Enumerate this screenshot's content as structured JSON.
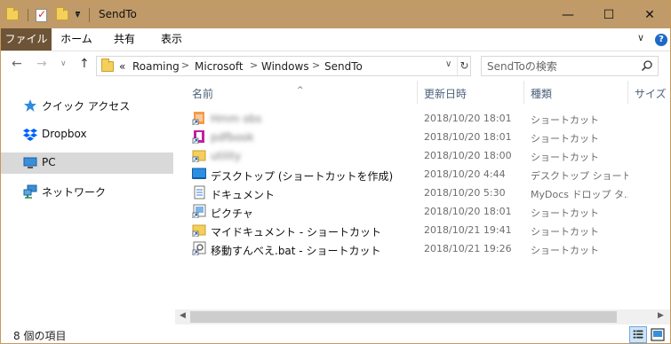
{
  "window": {
    "title": "SendTo",
    "minimize_glyph": "—",
    "maximize_glyph": "☐",
    "close_glyph": "✕"
  },
  "ribbon": {
    "tabs": [
      "ファイル",
      "ホーム",
      "共有",
      "表示"
    ],
    "expand_glyph": "∨",
    "help_glyph": "?"
  },
  "nav": {
    "back_glyph": "←",
    "forward_glyph": "→",
    "recent_glyph": "∨",
    "up_glyph": "↑",
    "overflow": "«",
    "breadcrumb": [
      "Roaming",
      "Microsoft",
      "Windows",
      "SendTo"
    ],
    "separator": ">",
    "dropdown_glyph": "∨",
    "refresh_glyph": "↻"
  },
  "search": {
    "placeholder": "SendToの検索"
  },
  "sidebar": {
    "items": [
      {
        "label": "クイック アクセス",
        "icon": "star-icon"
      },
      {
        "label": "Dropbox",
        "icon": "dropbox-icon"
      },
      {
        "label": "PC",
        "icon": "pc-icon",
        "selected": true
      },
      {
        "label": "ネットワーク",
        "icon": "network-icon"
      }
    ]
  },
  "columns": {
    "name": "名前",
    "modified": "更新日時",
    "type": "種類",
    "size": "サイズ",
    "sort_glyph": "^"
  },
  "files": [
    {
      "name": "Hmm obs",
      "date": "2018/10/20 18:01",
      "type": "ショートカット",
      "icon": "shortcut-orange-icon",
      "blurred": true
    },
    {
      "name": "pdfbook",
      "date": "2018/10/20 18:01",
      "type": "ショートカット",
      "icon": "shortcut-magenta-icon",
      "blurred": true
    },
    {
      "name": "utility",
      "date": "2018/10/20 18:00",
      "type": "ショートカット",
      "icon": "shortcut-folder-icon",
      "blurred": true
    },
    {
      "name": "デスクトップ (ショートカットを作成)",
      "date": "2018/10/20 4:44",
      "type": "デスクトップ ショートカ...",
      "icon": "desktop-icon"
    },
    {
      "name": "ドキュメント",
      "date": "2018/10/20 5:30",
      "type": "MyDocs ドロップ タ...",
      "icon": "document-icon"
    },
    {
      "name": "ピクチャ",
      "date": "2018/10/20 18:01",
      "type": "ショートカット",
      "icon": "picture-shortcut-icon"
    },
    {
      "name": "マイドキュメント - ショートカット",
      "date": "2018/10/21 19:41",
      "type": "ショートカット",
      "icon": "folder-shortcut-icon"
    },
    {
      "name": "移動すんべえ.bat - ショートカット",
      "date": "2018/10/21 19:26",
      "type": "ショートカット",
      "icon": "bat-shortcut-icon"
    }
  ],
  "status": {
    "item_count": "8 個の項目"
  },
  "colors": {
    "titlebar": "#c09a68",
    "file_tab": "#6e5436",
    "selection": "#d9d9d9",
    "accent": "#1d69c7"
  }
}
